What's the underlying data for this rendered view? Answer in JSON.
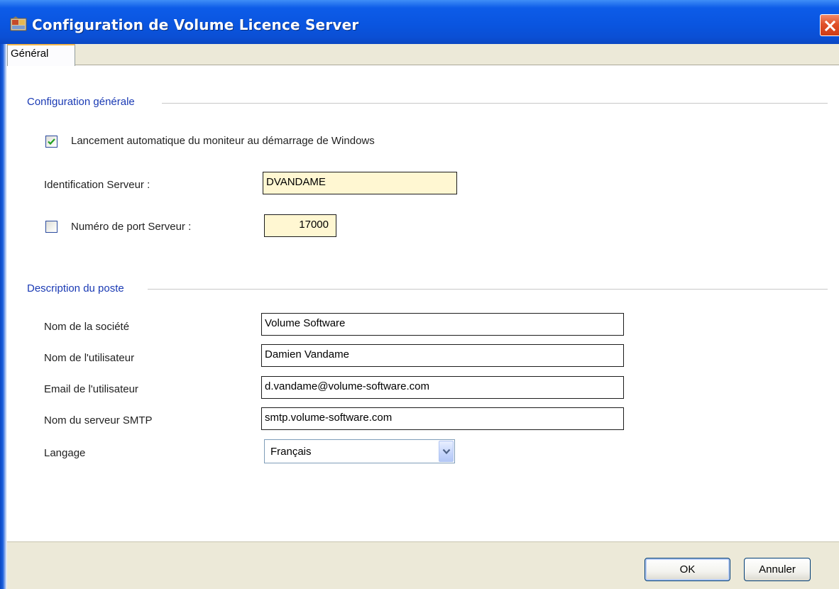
{
  "window": {
    "title": "Configuration de Volume Licence Server"
  },
  "tabs": [
    {
      "label": "Général",
      "selected": true
    }
  ],
  "general_config": {
    "group_title": "Configuration générale",
    "autostart": {
      "label": "Lancement automatique du moniteur au démarrage de Windows",
      "checked": true
    },
    "server_id": {
      "label": "Identification Serveur :",
      "value": "DVANDAME"
    },
    "server_port": {
      "label": "Numéro de port Serveur :",
      "checked": false,
      "value": "17000"
    }
  },
  "station_description": {
    "group_title": "Description du poste",
    "company": {
      "label": "Nom de la société",
      "value": "Volume Software"
    },
    "user_name": {
      "label": "Nom de l'utilisateur",
      "value": "Damien Vandame"
    },
    "user_email": {
      "label": "Email de l'utilisateur",
      "value": "d.vandame@volume-software.com"
    },
    "smtp_server": {
      "label": "Nom du serveur SMTP",
      "value": "smtp.volume-software.com"
    },
    "language": {
      "label": "Langage",
      "selected": "Français"
    }
  },
  "buttons": {
    "ok": "OK",
    "cancel": "Annuler"
  },
  "colors": {
    "titlebar": "#0a55e0",
    "group_title": "#1a3ab4",
    "highlight_field": "#fff7d2",
    "close_button": "#e0512a"
  },
  "icons": {
    "app": "volume-licence-app-icon",
    "close": "close-icon",
    "checkmark": "checkmark-icon",
    "dropdown": "chevron-down-icon"
  }
}
